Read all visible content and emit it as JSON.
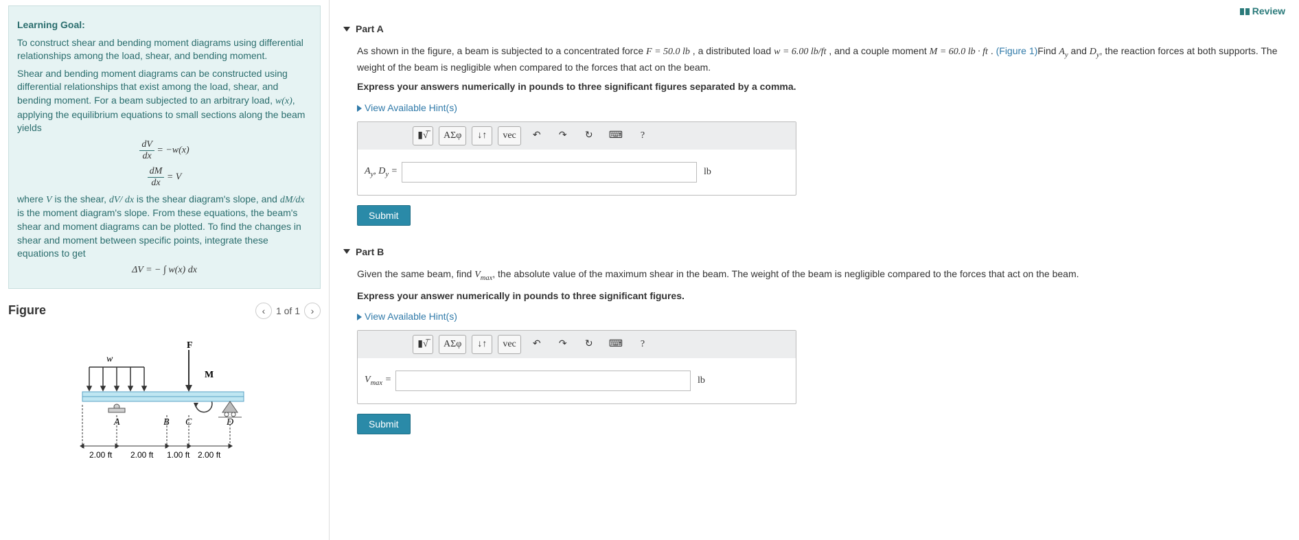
{
  "review_label": "Review",
  "left": {
    "title": "Learning Goal:",
    "p1": "To construct shear and bending moment diagrams using differential relationships among the load, shear, and bending moment.",
    "p2_a": "Shear and bending moment diagrams can be constructed using differential relationships that exist among the load, shear, and bending moment. For a beam subjected to an arbitrary load, ",
    "p2_b": ", applying the equilibrium equations to small sections along the beam yields",
    "eq1_lhs_num": "dV",
    "eq1_lhs_den": "dx",
    "eq1_rhs": "= −w(x)",
    "eq2_lhs_num": "dM",
    "eq2_lhs_den": "dx",
    "eq2_rhs": "= V",
    "p3_a": "where ",
    "p3_b": " is the shear, ",
    "p3_c": " is the shear diagram's slope, and ",
    "p3_d": " is the moment diagram's slope.  From these equations, the beam's shear and moment diagrams can be plotted.  To find the changes in shear and moment between specific points, integrate these equations to get",
    "eq3": "ΔV = − ∫ w(x) dx",
    "figure": "Figure",
    "pager_text": "1 of 1",
    "figlabels": {
      "F": "F",
      "w": "w",
      "M": "M",
      "A": "A",
      "B": "B",
      "C": "C",
      "D": "D",
      "d1": "2.00 ft",
      "d2": "2.00 ft",
      "d3": "1.00 ft",
      "d4": "2.00 ft"
    }
  },
  "partA": {
    "header": "Part A",
    "text_a": "As shown in the figure, a beam is subjected to a concentrated force ",
    "F_eq": "F = 50.0 lb",
    "text_b": " , a distributed load ",
    "w_eq": "w = 6.00 lb/ft",
    "text_c": " , and a couple moment ",
    "M_eq": "M = 60.0 lb · ft",
    "text_d": " .  ",
    "fig_ref": "(Figure 1)",
    "text_e": "Find ",
    "text_f": " and ",
    "text_g": ", the reaction forces at both supports. The weight of the beam is negligible when compared to the forces that act on the beam.",
    "instr": "Express your answers numerically in pounds to three significant figures separated by a comma.",
    "hints": "View Available Hint(s)",
    "label": "Aᵧ, Dᵧ =",
    "unit": "lb",
    "submit": "Submit"
  },
  "partB": {
    "header": "Part B",
    "text_a": "Given the same beam, find ",
    "text_b": ", the absolute value of the maximum shear in the beam. The weight of the beam is negligible compared to the forces that act on the beam.",
    "instr": "Express your answer numerically in pounds to three significant figures.",
    "hints": "View Available Hint(s)",
    "label_pre": "V",
    "label_sub": "max",
    "label_post": " =",
    "unit": "lb",
    "submit": "Submit"
  },
  "toolbar": {
    "templates": "▮√̅",
    "greek": "ΑΣφ",
    "subsup": "↓↑",
    "vec": "vec",
    "undo": "↶",
    "redo": "↷",
    "reset": "↻",
    "keyboard": "⌨",
    "help": "?"
  }
}
